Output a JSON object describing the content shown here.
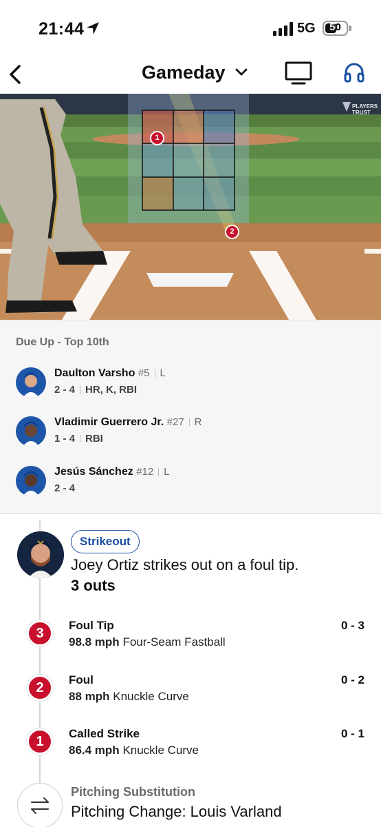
{
  "status_bar": {
    "time": "21:44",
    "network": "5G",
    "battery": "50"
  },
  "nav": {
    "title": "Gameday",
    "back_icon": "chevron-left-icon",
    "tv_icon": "tv-icon",
    "audio_icon": "headphones-icon"
  },
  "field": {
    "players_trust_logo": "PLAYERS TRUST",
    "pitches": [
      {
        "number": "1"
      },
      {
        "number": "2"
      }
    ]
  },
  "due_up": {
    "title": "Due Up - Top 10th",
    "players": [
      {
        "name": "Daulton Varsho",
        "number": "#5",
        "hand": "L",
        "line": "2 - 4",
        "events": "HR, K, RBI"
      },
      {
        "name": "Vladimir Guerrero Jr.",
        "number": "#27",
        "hand": "R",
        "line": "1 - 4",
        "events": "RBI"
      },
      {
        "name": "Jesús Sánchez",
        "number": "#12",
        "hand": "L",
        "line": "2 - 4",
        "events": ""
      }
    ]
  },
  "play": {
    "badge": "Strikeout",
    "description": "Joey Ortiz strikes out on a foul tip.",
    "outs": "3 outs",
    "pitches": [
      {
        "number": "3",
        "type": "Foul Tip",
        "speed": "98.8 mph",
        "pitch_name": "Four-Seam Fastball",
        "count": "0 - 3"
      },
      {
        "number": "2",
        "type": "Foul",
        "speed": "88 mph",
        "pitch_name": "Knuckle Curve",
        "count": "0 - 2"
      },
      {
        "number": "1",
        "type": "Called Strike",
        "speed": "86.4 mph",
        "pitch_name": "Knuckle Curve",
        "count": "0 - 1"
      }
    ]
  },
  "substitution": {
    "label": "Pitching Substitution",
    "description": "Pitching Change: Louis Varland"
  },
  "colors": {
    "accent_blue": "#1a4ea0",
    "pitch_red": "#c8102e",
    "zone_line": "#111111"
  }
}
